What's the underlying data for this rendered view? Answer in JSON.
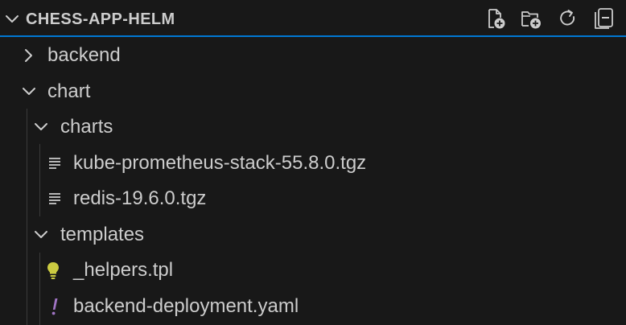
{
  "explorer": {
    "title": "CHESS-APP-HELM",
    "actions": [
      {
        "icon": "new-file-icon"
      },
      {
        "icon": "new-folder-icon"
      },
      {
        "icon": "refresh-icon"
      },
      {
        "icon": "collapse-all-icon"
      }
    ]
  },
  "tree": {
    "items": [
      {
        "label": "backend",
        "type": "folder",
        "expanded": false
      },
      {
        "label": "chart",
        "type": "folder",
        "expanded": true
      },
      {
        "label": "charts",
        "type": "folder",
        "expanded": true
      },
      {
        "label": "kube-prometheus-stack-55.8.0.tgz",
        "type": "file",
        "icon": "lines-file-icon"
      },
      {
        "label": "redis-19.6.0.tgz",
        "type": "file",
        "icon": "lines-file-icon"
      },
      {
        "label": "templates",
        "type": "folder",
        "expanded": true
      },
      {
        "label": "_helpers.tpl",
        "type": "file",
        "icon": "lightbulb-icon"
      },
      {
        "label": "backend-deployment.yaml",
        "type": "file",
        "icon": "exclamation-icon"
      }
    ]
  },
  "colors": {
    "background": "#181818",
    "text": "#cccccc",
    "focus_border": "#0078d4",
    "lightbulb": "#cbcb41",
    "yaml": "#a074c4"
  }
}
